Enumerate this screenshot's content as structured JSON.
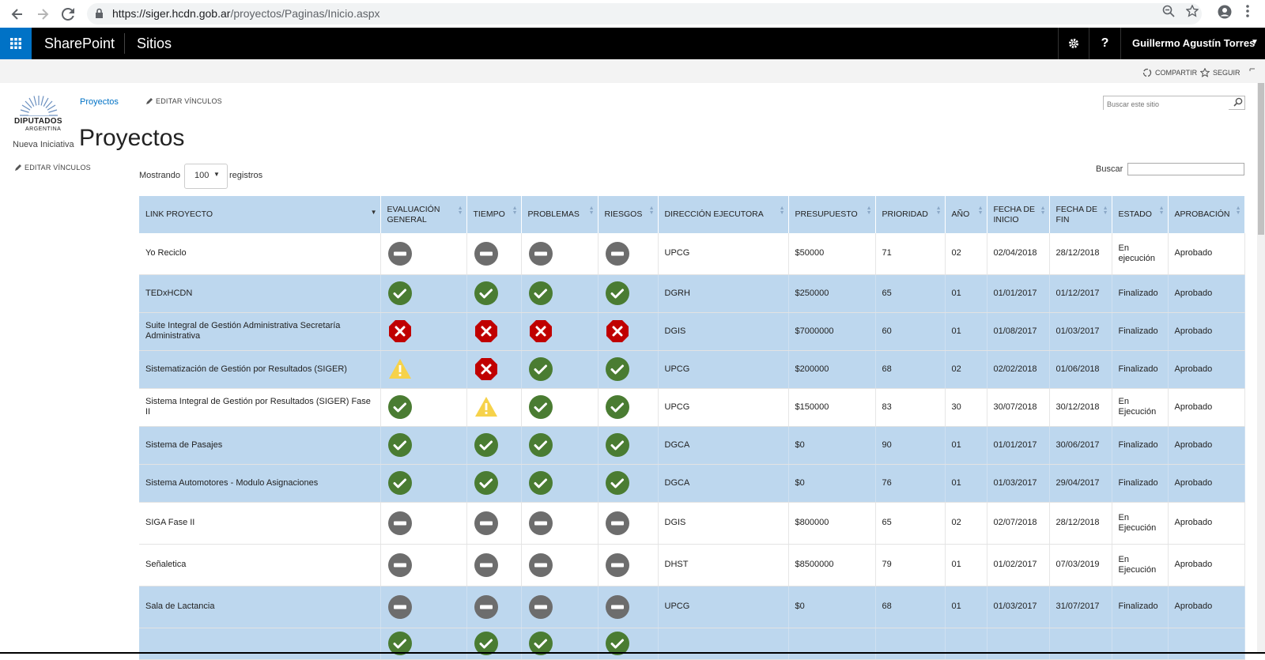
{
  "browser": {
    "url_host": "https://siger.hcdn.gob.ar",
    "url_path": "/proyectos/Paginas/Inicio.aspx"
  },
  "suitebar": {
    "brand": "SharePoint",
    "sitios": "Sitios",
    "user": "Guillermo Agustín Torres",
    "help": "?"
  },
  "ribbon": {
    "share": "COMPARTIR",
    "follow": "SEGUIR"
  },
  "logo": {
    "line1": "DIPUTADOS",
    "line2": "ARGENTINA"
  },
  "topnav": {
    "link": "Proyectos",
    "edit_links": "EDITAR VÍNCULOS"
  },
  "site_search": {
    "placeholder": "Buscar este sitio"
  },
  "quicklaunch": {
    "nueva": "Nueva Iniciativa",
    "edit_links": "EDITAR VÍNCULOS"
  },
  "page": {
    "title": "Proyectos"
  },
  "table_controls": {
    "showing": "Mostrando",
    "page_length": "100",
    "records": "registros",
    "search_label": "Buscar"
  },
  "colors": {
    "accent": "#0072c6",
    "header_bg": "#bdd7ee",
    "ok": "#4a7c32",
    "fail": "#c00000",
    "warn": "#f6d24a",
    "none": "#6d6d6d"
  },
  "table": {
    "headers": [
      "LINK PROYECTO",
      "EVALUACIÓN GENERAL",
      "TIEMPO",
      "PROBLEMAS",
      "RIESGOS",
      "DIRECCIÓN EJECUTORA",
      "PRESUPUESTO",
      "PRIORIDAD",
      "AÑO",
      "FECHA DE INICIO",
      "FECHA DE FIN",
      "ESTADO",
      "APROBACIÓN"
    ],
    "rows": [
      {
        "name": "Yo Reciclo",
        "eval": "none",
        "tiempo": "none",
        "problemas": "none",
        "riesgos": "none",
        "direccion": "UPCG",
        "presupuesto": "$50000",
        "prioridad": "71",
        "anio": "02",
        "inicio": "02/04/2018",
        "fin": "28/12/2018",
        "estado": "En ejecución",
        "aprobacion": "Aprobado",
        "highlight": false
      },
      {
        "name": "TEDxHCDN",
        "eval": "ok",
        "tiempo": "ok",
        "problemas": "ok",
        "riesgos": "ok",
        "direccion": "DGRH",
        "presupuesto": "$250000",
        "prioridad": "65",
        "anio": "01",
        "inicio": "01/01/2017",
        "fin": "01/12/2017",
        "estado": "Finalizado",
        "aprobacion": "Aprobado",
        "highlight": true
      },
      {
        "name": "Suite Integral de Gestión Administrativa Secretaría Administrativa",
        "eval": "fail",
        "tiempo": "fail",
        "problemas": "fail",
        "riesgos": "fail",
        "direccion": "DGIS",
        "presupuesto": "$7000000",
        "prioridad": "60",
        "anio": "01",
        "inicio": "01/08/2017",
        "fin": "01/03/2017",
        "estado": "Finalizado",
        "aprobacion": "Aprobado",
        "highlight": true
      },
      {
        "name": "Sistematización de Gestión por Resultados (SIGER)",
        "eval": "warn",
        "tiempo": "fail",
        "problemas": "ok",
        "riesgos": "ok",
        "direccion": "UPCG",
        "presupuesto": "$200000",
        "prioridad": "68",
        "anio": "02",
        "inicio": "02/02/2018",
        "fin": "01/06/2018",
        "estado": "Finalizado",
        "aprobacion": "Aprobado",
        "highlight": true
      },
      {
        "name": "Sistema Integral de Gestión por Resultados (SIGER) Fase II",
        "eval": "ok",
        "tiempo": "warn",
        "problemas": "ok",
        "riesgos": "ok",
        "direccion": "UPCG",
        "presupuesto": "$150000",
        "prioridad": "83",
        "anio": "30",
        "inicio": "30/07/2018",
        "fin": "30/12/2018",
        "estado": "En Ejecución",
        "aprobacion": "Aprobado",
        "highlight": false
      },
      {
        "name": "Sistema de Pasajes",
        "eval": "ok",
        "tiempo": "ok",
        "problemas": "ok",
        "riesgos": "ok",
        "direccion": "DGCA",
        "presupuesto": "$0",
        "prioridad": "90",
        "anio": "01",
        "inicio": "01/01/2017",
        "fin": "30/06/2017",
        "estado": "Finalizado",
        "aprobacion": "Aprobado",
        "highlight": true
      },
      {
        "name": "Sistema Automotores - Modulo Asignaciones",
        "eval": "ok",
        "tiempo": "ok",
        "problemas": "ok",
        "riesgos": "ok",
        "direccion": "DGCA",
        "presupuesto": "$0",
        "prioridad": "76",
        "anio": "01",
        "inicio": "01/03/2017",
        "fin": "29/04/2017",
        "estado": "Finalizado",
        "aprobacion": "Aprobado",
        "highlight": true
      },
      {
        "name": "SIGA Fase II",
        "eval": "none",
        "tiempo": "none",
        "problemas": "none",
        "riesgos": "none",
        "direccion": "DGIS",
        "presupuesto": "$800000",
        "prioridad": "65",
        "anio": "02",
        "inicio": "02/07/2018",
        "fin": "28/12/2018",
        "estado": "En Ejecución",
        "aprobacion": "Aprobado",
        "highlight": false
      },
      {
        "name": "Señaletica",
        "eval": "none",
        "tiempo": "none",
        "problemas": "none",
        "riesgos": "none",
        "direccion": "DHST",
        "presupuesto": "$8500000",
        "prioridad": "79",
        "anio": "01",
        "inicio": "01/02/2017",
        "fin": "07/03/2019",
        "estado": "En Ejecución",
        "aprobacion": "Aprobado",
        "highlight": false
      },
      {
        "name": "Sala de Lactancia",
        "eval": "none",
        "tiempo": "none",
        "problemas": "none",
        "riesgos": "none",
        "direccion": "UPCG",
        "presupuesto": "$0",
        "prioridad": "68",
        "anio": "01",
        "inicio": "01/03/2017",
        "fin": "31/07/2017",
        "estado": "Finalizado",
        "aprobacion": "Aprobado",
        "highlight": true
      },
      {
        "name": "",
        "eval": "ok",
        "tiempo": "ok",
        "problemas": "ok",
        "riesgos": "ok",
        "direccion": "",
        "presupuesto": "",
        "prioridad": "",
        "anio": "",
        "inicio": "",
        "fin": "",
        "estado": "",
        "aprobacion": "",
        "highlight": true
      }
    ]
  }
}
